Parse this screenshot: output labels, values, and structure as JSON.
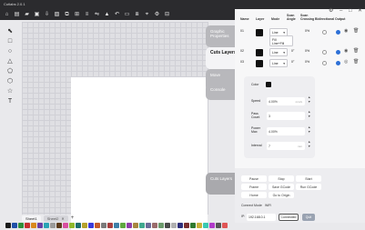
{
  "app": {
    "title": "Cutlabs 2.0.1"
  },
  "toolbar": {
    "buttons": [
      {
        "name": "logo-icon",
        "glyph": "⌂"
      },
      {
        "name": "new-file-icon",
        "glyph": "▤"
      },
      {
        "name": "open-folder-icon",
        "glyph": "▰"
      },
      {
        "name": "save-icon",
        "glyph": "▣"
      },
      {
        "name": "import-icon",
        "glyph": "⇩"
      },
      {
        "name": "image-icon",
        "glyph": "▨"
      },
      {
        "name": "group-icon",
        "glyph": "⧉"
      },
      {
        "name": "ungroup-icon",
        "glyph": "⊞"
      },
      {
        "name": "align-icon",
        "glyph": "≡"
      },
      {
        "name": "mirror-icon",
        "glyph": "⇋"
      },
      {
        "name": "fill-icon",
        "glyph": "▲"
      },
      {
        "name": "undo-icon",
        "glyph": "↶"
      },
      {
        "name": "frame-icon",
        "glyph": "▭"
      },
      {
        "name": "layers-icon",
        "glyph": "⧈"
      },
      {
        "name": "trace-icon",
        "glyph": "⌖"
      },
      {
        "name": "settings-icon",
        "glyph": "⚙"
      },
      {
        "name": "grid-icon",
        "glyph": "⊟"
      }
    ]
  },
  "tools": [
    {
      "name": "select-tool-icon",
      "glyph": "⬉"
    },
    {
      "name": "rectangle-tool-icon",
      "glyph": "□"
    },
    {
      "name": "ellipse-tool-icon",
      "glyph": "○"
    },
    {
      "name": "triangle-tool-icon",
      "glyph": "△"
    },
    {
      "name": "pentagon-tool-icon",
      "glyph": "⬠"
    },
    {
      "name": "hexagon-tool-icon",
      "glyph": "⬡"
    },
    {
      "name": "star-tool-icon",
      "glyph": "☆"
    },
    {
      "name": "text-tool-icon",
      "glyph": "T"
    }
  ],
  "tabs": [
    {
      "label": "Sheet1",
      "active": true
    },
    {
      "label": "Sheet2",
      "active": false
    }
  ],
  "tab_close": "✕",
  "tab_add": "+",
  "palette": [
    "#1a1a1a",
    "#1f4fa8",
    "#2f8f3a",
    "#c62f2f",
    "#d9891e",
    "#6a3fa5",
    "#2aa3b5",
    "#9a9a9a",
    "#5c3b1c",
    "#d94fa0",
    "#8fb82a",
    "#1e6d6d",
    "#b5a22a",
    "#3a3ad9",
    "#c45a2a",
    "#7a7a7a",
    "#a83f3f",
    "#3f7fa8",
    "#5fa83f",
    "#8f3fa8",
    "#a8863f",
    "#3fa88f",
    "#6b6b9a",
    "#9a6b6b",
    "#6b9a6b",
    "#4a4a4a",
    "#b0b0b0",
    "#2f2f7a",
    "#7a2f2f",
    "#2f7a2f",
    "#c9b13a",
    "#3ac9b1",
    "#b13ac9",
    "#555555",
    "#e05555"
  ],
  "side_tabs": {
    "graphic": "Graphic Properties",
    "cuts": "Cuts Layers",
    "move": "Move",
    "console": "Console",
    "cuts_bottom": "Cuts Layers"
  },
  "window_controls": {
    "settings": "⚙",
    "minimize": "–",
    "maximize": "□",
    "close": "✕"
  },
  "layers_table": {
    "headers": [
      "Name",
      "Layer",
      "Mode",
      "Scan Angle",
      "Scan Crossing",
      "Bidirectional",
      "Output"
    ],
    "rows": [
      {
        "name": "01",
        "color": "#111111",
        "mode": "Line",
        "angle": "",
        "crossing": "0%",
        "output": true
      },
      {
        "name": "02",
        "color": "#111111",
        "mode": "Line",
        "angle": "0°",
        "crossing": "0%",
        "output": true
      },
      {
        "name": "03",
        "color": "#111111",
        "mode": "Line",
        "angle": "0°",
        "crossing": "0%",
        "output": true
      }
    ],
    "dropdown_options": [
      "Fill",
      "Line+Fill"
    ],
    "chevron": "▾",
    "eye_glyph": "◉",
    "eye_off_glyph": "◎",
    "trash_glyph": "🗑"
  },
  "settings": {
    "color_label": "Color",
    "color_value": "#111111",
    "fields": [
      {
        "label": "Speed",
        "value": "4.00%",
        "unit": "mm/s"
      },
      {
        "label": "Pass Count",
        "value": "3",
        "unit": ""
      },
      {
        "label": "Power Max",
        "value": "4.00%",
        "unit": ""
      },
      {
        "label": "Interval",
        "value": "7",
        "unit": "mm"
      }
    ],
    "step_up": "▲",
    "step_down": "▼"
  },
  "controls": {
    "buttons_row1": [
      "Pause",
      "Stop",
      "Start"
    ],
    "buttons_row2": [
      "Frame",
      "Save GCode",
      "Run GCode"
    ],
    "buttons_row3": [
      "Home",
      "Go to Origin"
    ],
    "connect_mode_label": "Connect Mode",
    "connect_mode_value": "WiFi",
    "ip_label": "IP:",
    "ip_value": "192.168.0.1",
    "connected_label": "Connected",
    "quit_label": "Quit"
  }
}
